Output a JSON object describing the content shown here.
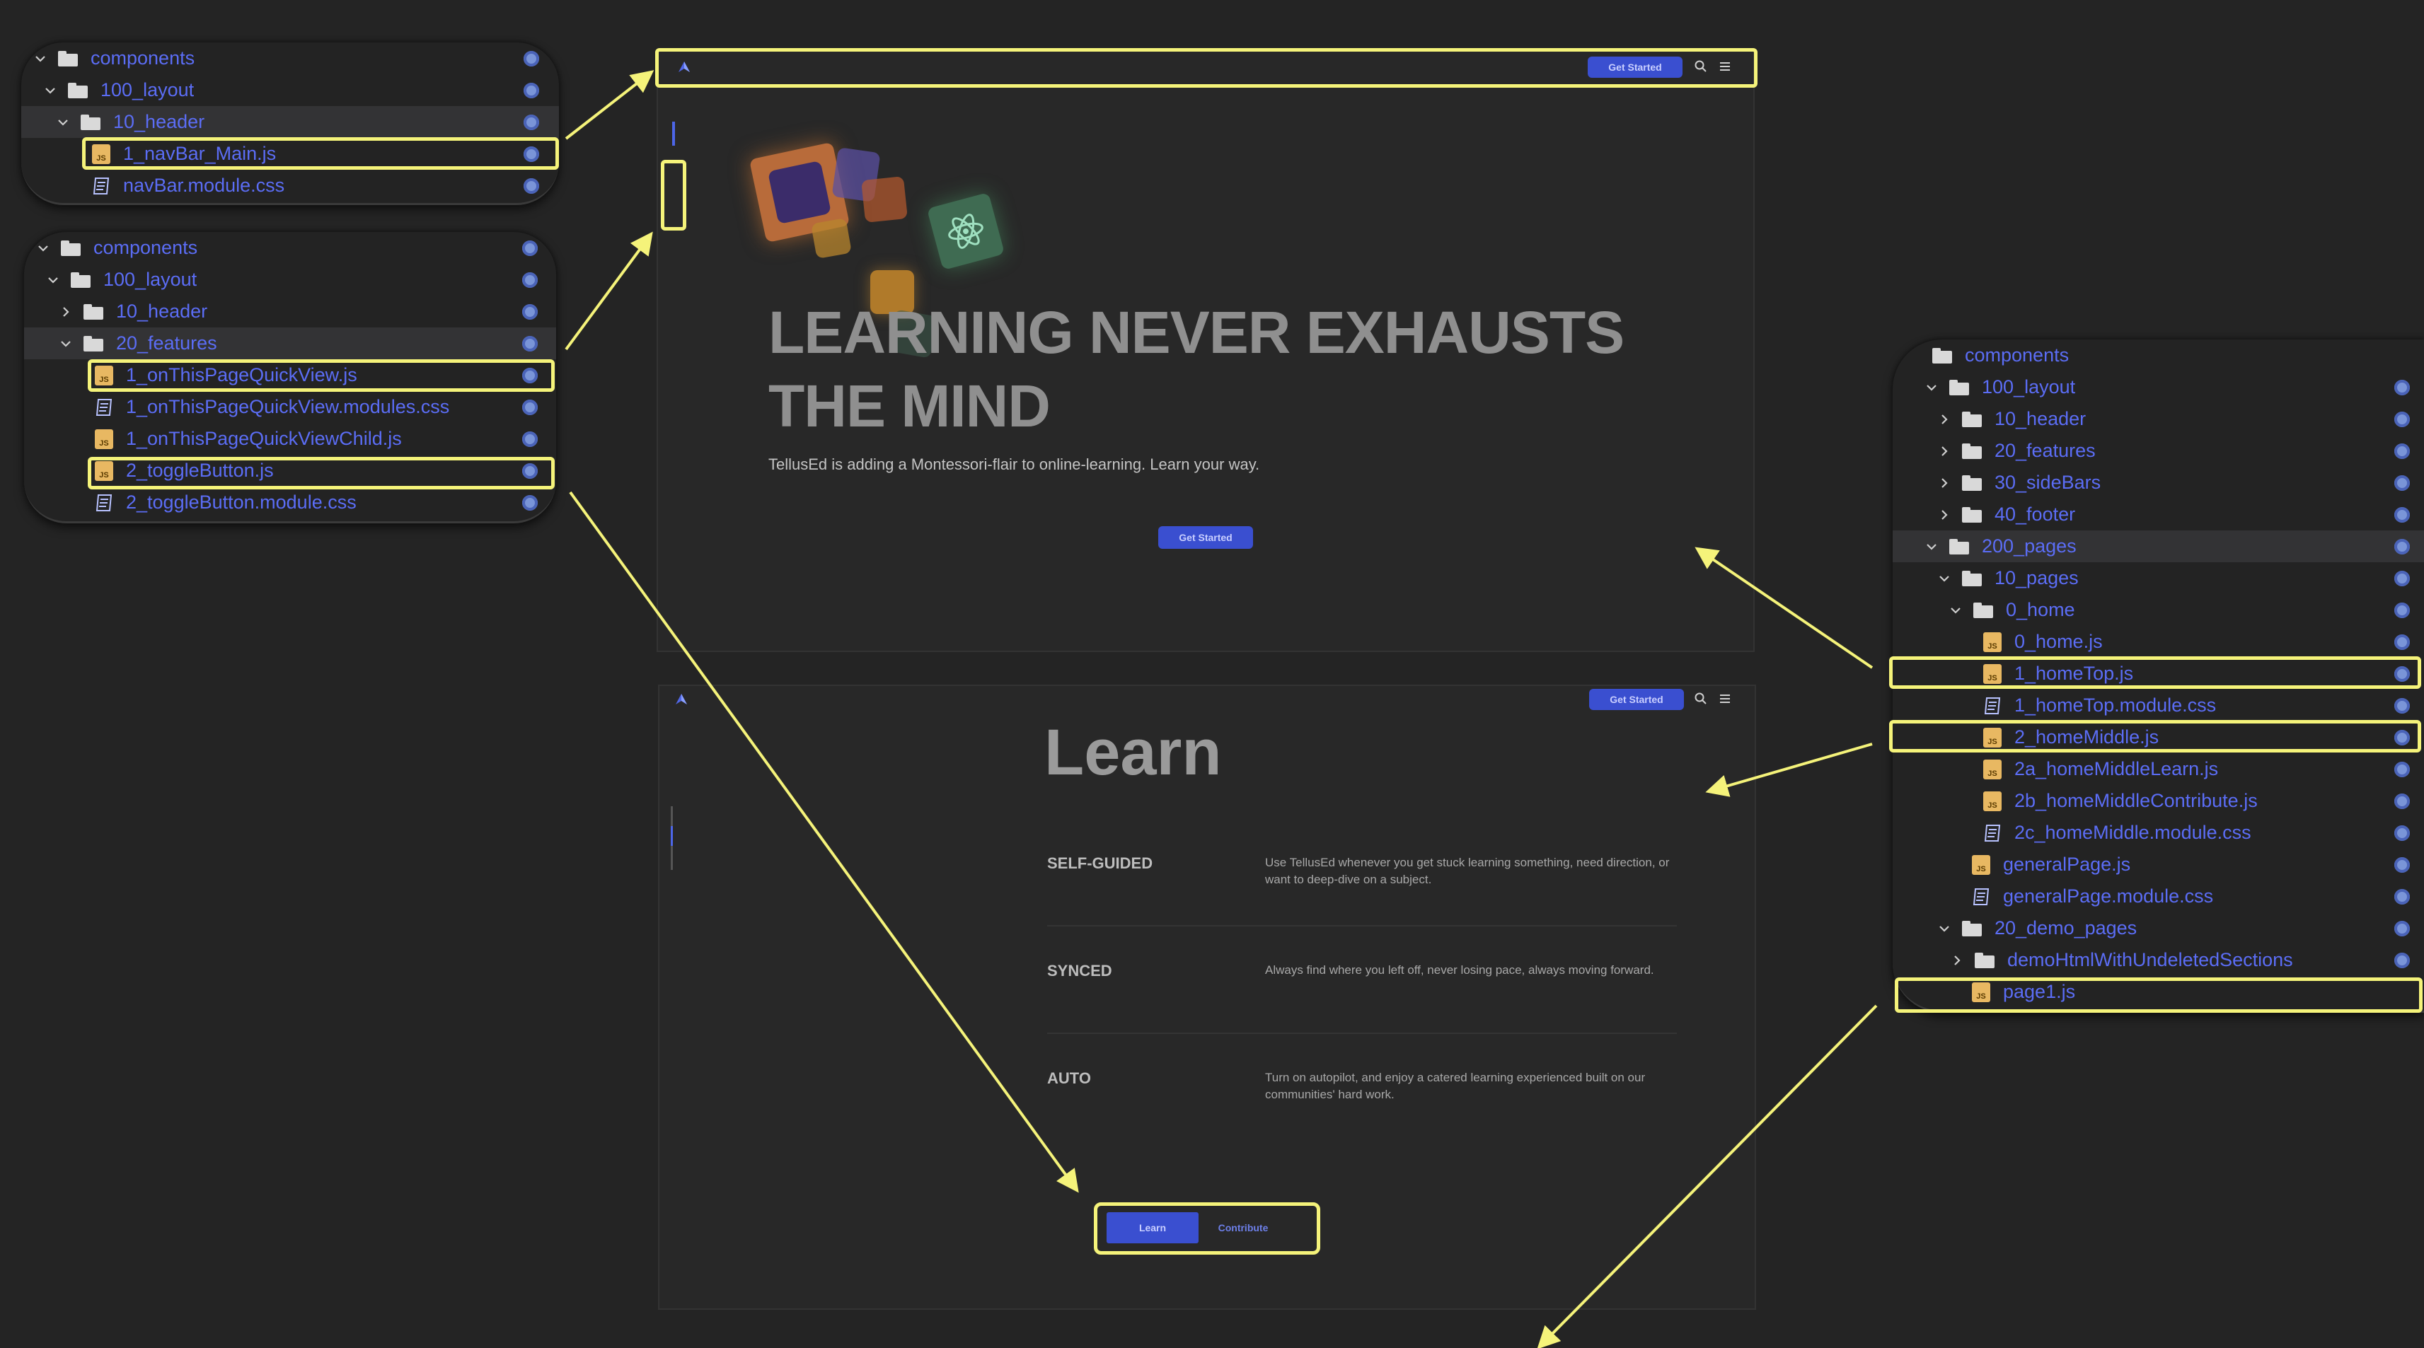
{
  "tree_nav": {
    "rows": [
      {
        "label": "components"
      },
      {
        "label": "100_layout"
      },
      {
        "label": "10_header"
      },
      {
        "label": "1_navBar_Main.js"
      },
      {
        "label": "navBar.module.css"
      }
    ]
  },
  "tree_features": {
    "rows": [
      {
        "label": "components"
      },
      {
        "label": "100_layout"
      },
      {
        "label": "10_header"
      },
      {
        "label": "20_features"
      },
      {
        "label": "1_onThisPageQuickView.js"
      },
      {
        "label": "1_onThisPageQuickView.modules.css"
      },
      {
        "label": "1_onThisPageQuickViewChild.js"
      },
      {
        "label": "2_toggleButton.js"
      },
      {
        "label": "2_toggleButton.module.css"
      }
    ]
  },
  "tree_pages": {
    "rows": [
      {
        "label": "components"
      },
      {
        "label": "100_layout"
      },
      {
        "label": "10_header"
      },
      {
        "label": "20_features"
      },
      {
        "label": "30_sideBars"
      },
      {
        "label": "40_footer"
      },
      {
        "label": "200_pages"
      },
      {
        "label": "10_pages"
      },
      {
        "label": "0_home"
      },
      {
        "label": "0_home.js"
      },
      {
        "label": "1_homeTop.js"
      },
      {
        "label": "1_homeTop.module.css"
      },
      {
        "label": "2_homeMiddle.js"
      },
      {
        "label": "2a_homeMiddleLearn.js"
      },
      {
        "label": "2b_homeMiddleContribute.js"
      },
      {
        "label": "2c_homeMiddle.module.css"
      },
      {
        "label": "generalPage.js"
      },
      {
        "label": "generalPage.module.css"
      },
      {
        "label": "20_demo_pages"
      },
      {
        "label": "demoHtmlWithUndeletedSections"
      },
      {
        "label": "page1.js"
      }
    ]
  },
  "home_top": {
    "get_started_nav": "Get Started",
    "title_line1": "LEARNING NEVER EXHAUSTS",
    "title_line2": "THE MIND",
    "subtitle": "TellusEd is adding a Montessori-flair to online-learning. Learn your way.",
    "get_started_cta": "Get Started"
  },
  "home_middle": {
    "get_started_nav": "Get Started",
    "title": "Learn",
    "features": [
      {
        "name": "SELF-GUIDED",
        "desc": "Use TellusEd whenever you get stuck learning something, need direction, or want to deep-dive on a subject."
      },
      {
        "name": "SYNCED",
        "desc": "Always find where you left off, never losing pace, always moving forward."
      },
      {
        "name": "AUTO",
        "desc": "Turn on autopilot, and enjoy a catered learning experienced built on our communities' hard work."
      }
    ],
    "toggle_learn": "Learn",
    "toggle_contribute": "Contribute"
  },
  "colors": {
    "background": "#242424",
    "tree_label": "#5b6df5",
    "accent_button": "#3a4fd0",
    "highlight": "#f5f37a"
  }
}
